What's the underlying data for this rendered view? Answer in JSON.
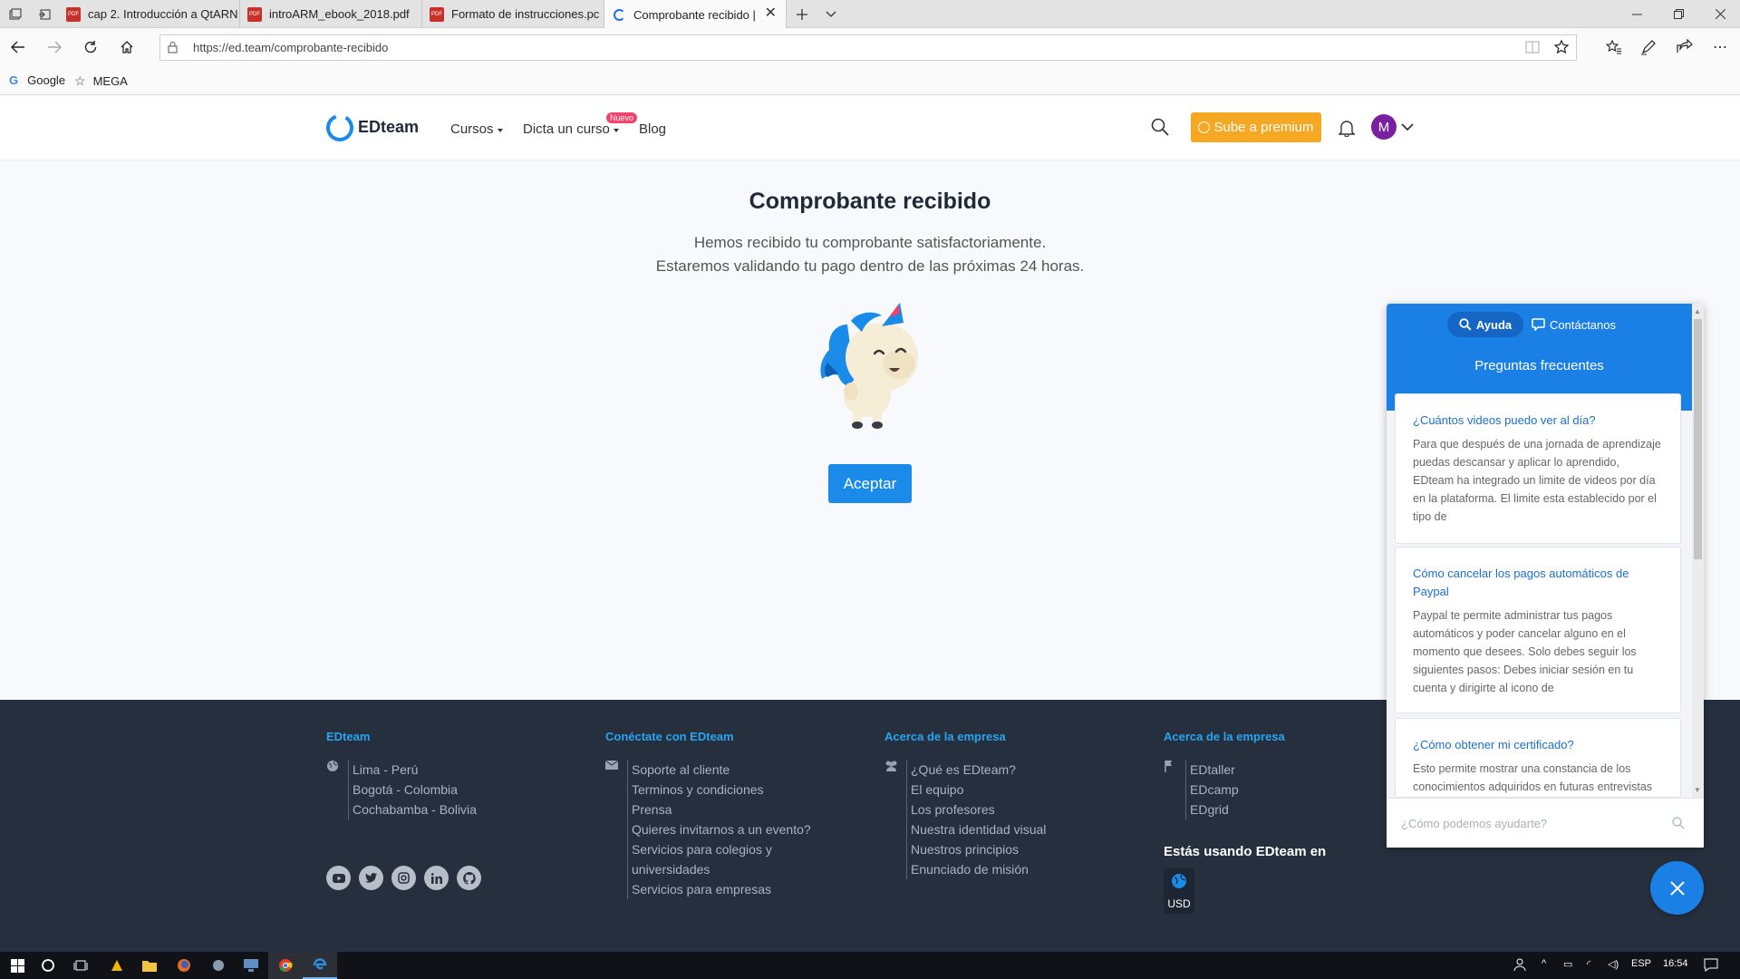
{
  "browser": {
    "tabs": [
      {
        "label": "cap 2. Introducción a QtARN",
        "icon": "pdf-icon"
      },
      {
        "label": "introARM_ebook_2018.pdf",
        "icon": "pdf-icon"
      },
      {
        "label": "Formato de instrucciones.pc",
        "icon": "pdf-icon"
      },
      {
        "label": "Comprobante recibido |",
        "icon": "loading-spinner-icon",
        "active": true
      }
    ],
    "url": "https://ed.team/comprobante-recibido",
    "bookmarks": [
      {
        "label": "Google",
        "icon": "google-icon"
      },
      {
        "label": "MEGA",
        "icon": "star-icon"
      }
    ]
  },
  "header": {
    "logo": "EDteam",
    "nav": [
      {
        "label": "Cursos",
        "dropdown": true
      },
      {
        "label": "Dicta un curso",
        "dropdown": true,
        "badge": "Nuevo"
      },
      {
        "label": "Blog",
        "dropdown": false
      }
    ],
    "premium_label": "Sube a premium",
    "avatar_initial": "M",
    "colors": {
      "premium": "#f7a823",
      "avatar": "#7a1fa2",
      "badge": "#f2436a"
    }
  },
  "main": {
    "title": "Comprobante recibido",
    "message_line1": "Hemos recibido tu comprobante satisfactoriamente.",
    "message_line2": "Estaremos validando tu pago dentro de las próximas 24 horas.",
    "accept_label": "Aceptar",
    "accent": "#1a8be8"
  },
  "footer": {
    "columns": [
      {
        "heading": "EDteam",
        "icon": "globe-icon",
        "items": [
          "Lima - Perú",
          "Bogotá - Colombia",
          "Cochabamba - Bolivia"
        ]
      },
      {
        "heading": "Conéctate con EDteam",
        "icon": "envelope-icon",
        "items": [
          "Soporte al cliente",
          "Terminos y condiciones",
          "Prensa",
          "Quieres invitarnos a un evento?",
          "Servicios para colegios y",
          "universidades",
          "Servicios para empresas"
        ]
      },
      {
        "heading": "Acerca de la empresa",
        "icon": "users-icon",
        "items": [
          "¿Qué es EDteam?",
          "El equipo",
          "Los profesores",
          "Nuestra identidad visual",
          "Nuestros principios",
          "Enunciado de misión"
        ]
      },
      {
        "heading": "Acerca de la empresa",
        "icon": "flag-icon",
        "items": [
          "EDtaller",
          "EDcamp",
          "EDgrid"
        ]
      }
    ],
    "social": [
      "youtube-icon",
      "twitter-icon",
      "instagram-icon",
      "linkedin-icon",
      "github-icon"
    ],
    "using_label": "Estás usando EDteam en",
    "currency": "USD"
  },
  "help_widget": {
    "tab_help": "Ayuda",
    "tab_contact": "Contáctanos",
    "title": "Preguntas frecuentes",
    "faqs": [
      {
        "question": "¿Cuántos videos puedo ver al día?",
        "answer": "Para que después de una jornada de aprendizaje puedas descansar y aplicar lo aprendido, EDteam ha integrado un limite de videos por día en la plataforma. El limite esta establecido por el tipo de"
      },
      {
        "question": "Cómo cancelar los pagos automáticos de Paypal",
        "answer": "Paypal te permite administrar tus pagos automáticos y poder cancelar alguno en el momento que desees. Solo debes seguir los siguientes pasos: Debes iniciar sesión en tu cuenta y dirigirte al icono de"
      },
      {
        "question": "¿Cómo obtener mi certificado?",
        "answer": "Esto permite mostrar una constancia de los conocimientos adquiridos en futuras entrevistas"
      }
    ],
    "search_placeholder": "¿Cómo podemos ayudarte?",
    "accent": "#1a80e6"
  },
  "taskbar": {
    "language": "ESP",
    "time": "16:54"
  }
}
